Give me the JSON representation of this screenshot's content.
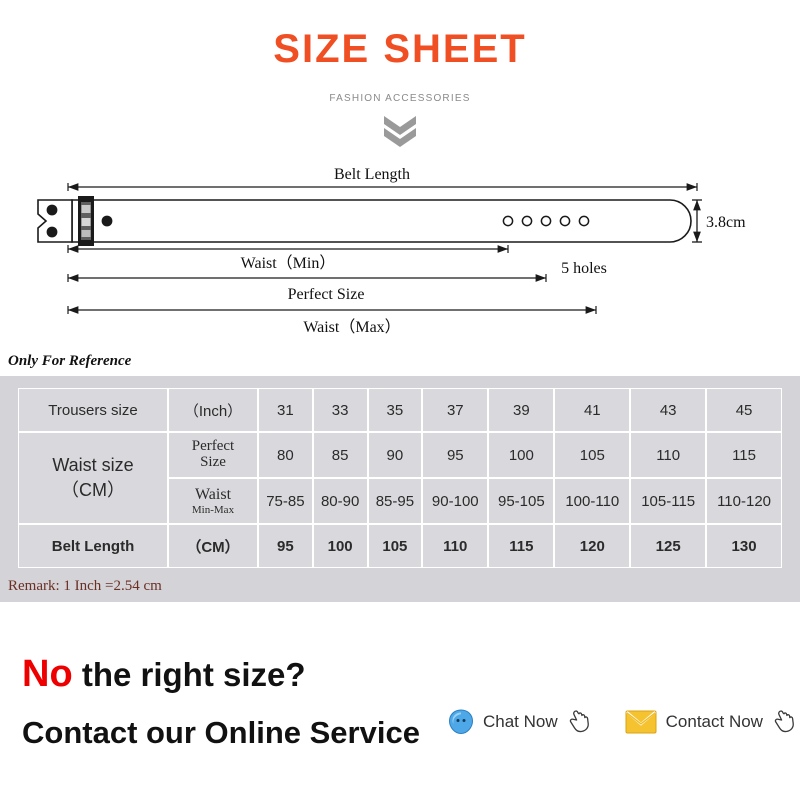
{
  "header": {
    "title": "SIZE SHEET",
    "subtitle": "FASHION ACCESSORIES",
    "title_color": "#f04e23",
    "chevron_icon": "double-chevron-down-icon"
  },
  "diagram": {
    "belt_length_label": "Belt Length",
    "waist_min_label": "Waist（Min）",
    "perfect_size_label": "Perfect Size",
    "waist_max_label": "Waist（Max）",
    "width_label": "3.8cm",
    "holes_label": "5 holes",
    "holes_count": 5
  },
  "table_section": {
    "note_above": "Only For Reference",
    "remark": "Remark: 1 Inch =2.54 cm",
    "remark_color": "#6b2f24",
    "panel_color": "#d4d4d8",
    "cell_color": "#d9d9dd"
  },
  "chart_data": {
    "type": "table",
    "title": "Size Sheet",
    "row_headers": [
      "Trousers size",
      "Waist size（CM）",
      "Belt Length"
    ],
    "sub_headers": [
      "（Inch）",
      "Perfect Size",
      "Waist Min-Max",
      "（CM）"
    ],
    "rows": [
      {
        "label": "Trousers size",
        "unit": "（Inch）",
        "values": [
          "31",
          "33",
          "35",
          "37",
          "39",
          "41",
          "43",
          "45"
        ]
      },
      {
        "label": "Waist size（CM）",
        "unit": "Perfect Size",
        "values": [
          "80",
          "85",
          "90",
          "95",
          "100",
          "105",
          "110",
          "115"
        ]
      },
      {
        "label": "Waist size（CM）",
        "unit": "Waist Min-Max",
        "values": [
          "75-85",
          "80-90",
          "85-95",
          "90-100",
          "95-105",
          "100-110",
          "105-115",
          "110-120"
        ]
      },
      {
        "label": "Belt Length",
        "unit": "（CM）",
        "values": [
          "95",
          "100",
          "105",
          "110",
          "115",
          "120",
          "125",
          "130"
        ]
      }
    ]
  },
  "table": {
    "r1_label": "Trousers size",
    "r1_unit": "（Inch）",
    "r1_values": [
      "31",
      "33",
      "35",
      "37",
      "39",
      "41",
      "43",
      "45"
    ],
    "r2_label_line1": "Waist size",
    "r2_label_line2": "（CM）",
    "r2_unit_line1": "Perfect",
    "r2_unit_line2": "Size",
    "r2_values": [
      "80",
      "85",
      "90",
      "95",
      "100",
      "105",
      "110",
      "115"
    ],
    "r3_unit_line1": "Waist",
    "r3_unit_line2": "Min-Max",
    "r3_values": [
      "75-85",
      "80-90",
      "85-95",
      "90-100",
      "95-105",
      "100-110",
      "105-115",
      "110-120"
    ],
    "r4_label": "Belt Length",
    "r4_unit": "（CM）",
    "r4_values": [
      "95",
      "100",
      "105",
      "110",
      "115",
      "120",
      "125",
      "130"
    ]
  },
  "footer": {
    "no_word": "No",
    "no_rest": " the right size?",
    "no_color": "#ee0000",
    "contact_line": "Contact our Online Service",
    "chat_label": "Chat Now",
    "contact_label": "Contact Now",
    "chat_icon": "chat-bubble-icon",
    "mail_icon": "envelope-icon",
    "cursor_icon": "hand-pointer-icon"
  }
}
